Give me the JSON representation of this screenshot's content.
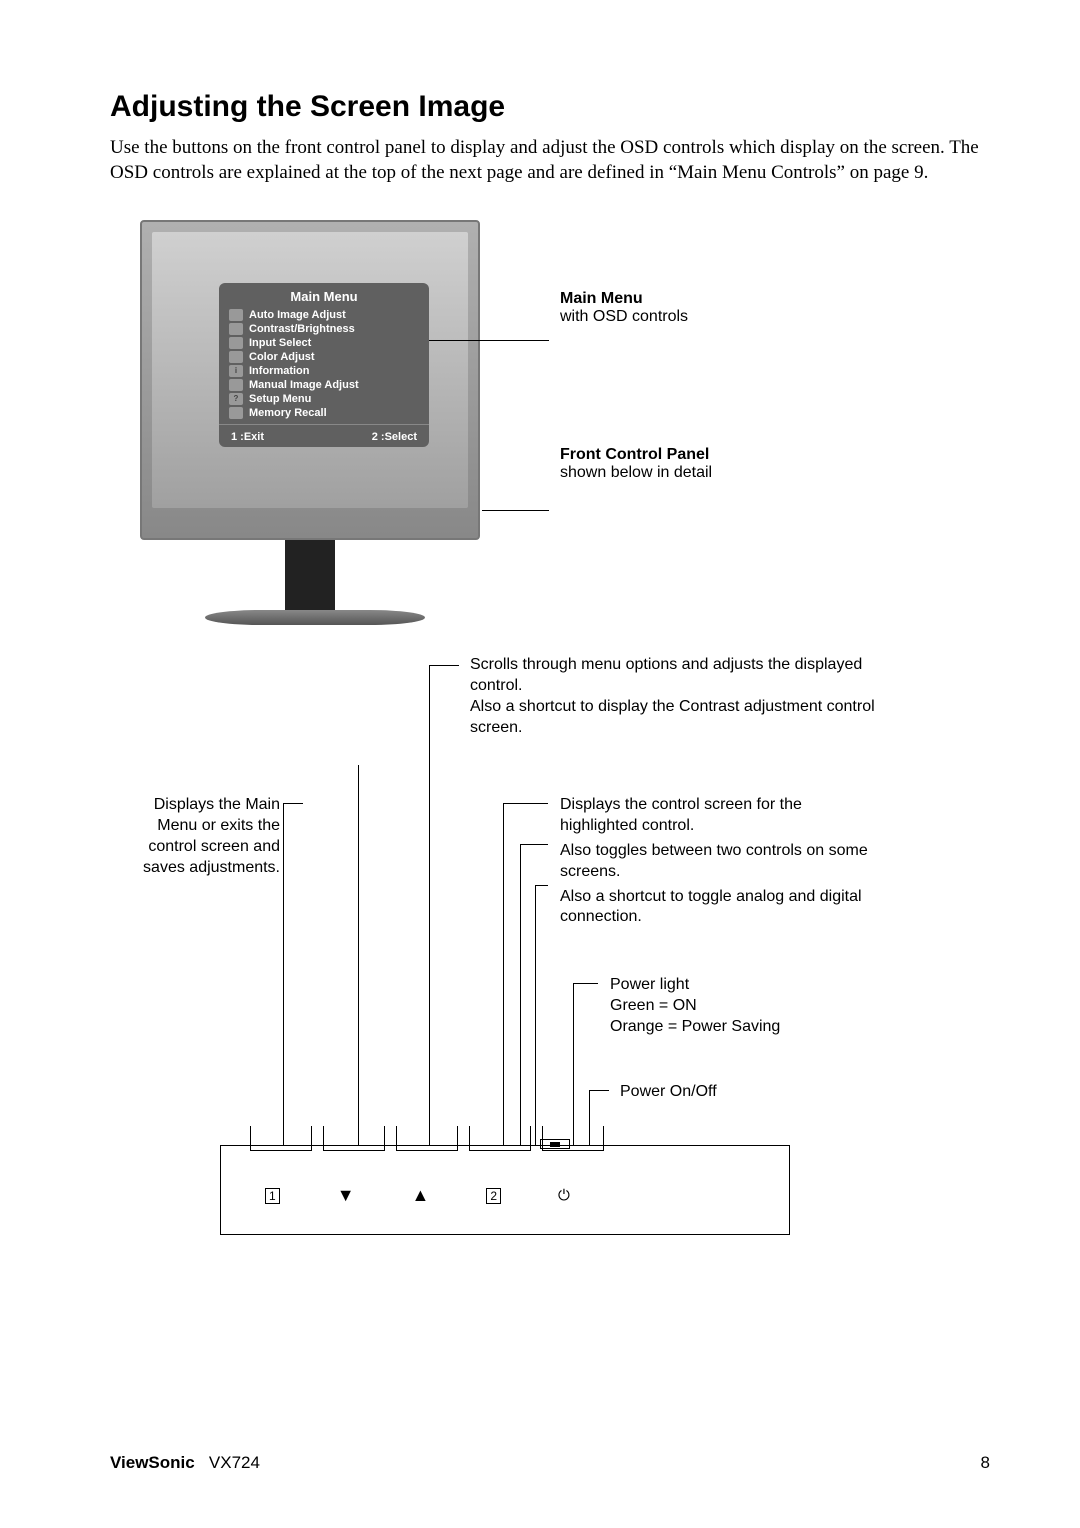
{
  "title": "Adjusting the Screen Image",
  "intro": "Use the buttons on the front control panel to display and adjust the OSD controls which display on the screen. The OSD controls are explained at the top of the next page and are defined in “Main Menu Controls” on page 9.",
  "osd": {
    "title": "Main Menu",
    "items": [
      "Auto Image Adjust",
      "Contrast/Brightness",
      "Input Select",
      "Color Adjust",
      "Information",
      "Manual Image Adjust",
      "Setup Menu",
      "Memory Recall"
    ],
    "footer_left": "1 :Exit",
    "footer_right": "2 :Select"
  },
  "side": {
    "main_menu_heading": "Main Menu",
    "main_menu_sub": "with OSD controls",
    "panel_heading": "Front Control Panel",
    "panel_sub": "shown below in detail"
  },
  "callouts": {
    "up_1": "Scrolls through menu options and adjusts the displayed control.",
    "up_2": "Also a shortcut to display the Contrast adjustment control screen.",
    "left": "Displays the Main Menu or exits the control screen and saves adjustments.",
    "two_1": "Displays the control screen for the highlighted control.",
    "two_2": "Also toggles between two controls on some screens.",
    "two_3": "Also a shortcut to toggle analog and digital connection.",
    "power_light_1": "Power light",
    "power_light_2": "Green = ON",
    "power_light_3": "Orange = Power Saving",
    "power_btn": "Power On/Off"
  },
  "panel": {
    "btn1": "1",
    "btn_down": "▼",
    "btn_up": "▲",
    "btn2": "2",
    "btn_power": "⏻"
  },
  "footer": {
    "brand": "ViewSonic",
    "model": "VX724",
    "page": "8"
  }
}
